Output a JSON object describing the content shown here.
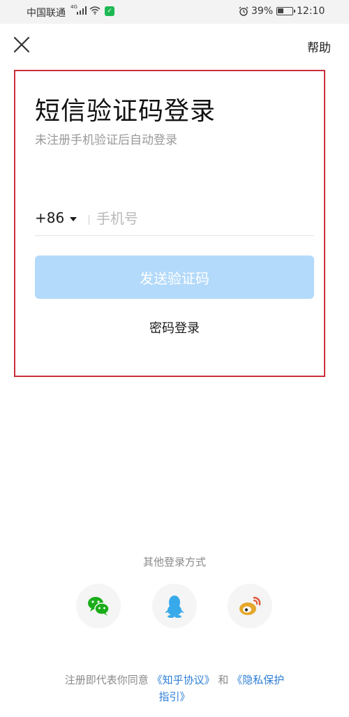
{
  "status_bar": {
    "carrier": "中国联通",
    "network": "4G",
    "battery_percent": "39%",
    "time": "12:10"
  },
  "header": {
    "close_icon": "close-icon",
    "help_label": "帮助"
  },
  "login": {
    "title": "短信验证码登录",
    "subtitle": "未注册手机验证后自动登录",
    "country_code": "+86",
    "phone_placeholder": "手机号",
    "phone_value": "",
    "send_code_label": "发送验证码",
    "password_login_label": "密码登录"
  },
  "other_login": {
    "label": "其他登录方式",
    "providers": [
      {
        "name": "wechat",
        "icon": "wechat-icon",
        "color": "#1aad19"
      },
      {
        "name": "qq",
        "icon": "qq-icon",
        "color": "#38a9ea"
      },
      {
        "name": "weibo",
        "icon": "weibo-icon",
        "color": "#e6a82c"
      }
    ]
  },
  "terms": {
    "prefix": "注册即代表你同意",
    "agreement_link": "《知乎协议》",
    "and": "和",
    "privacy_link_line1": "《隐私保护",
    "privacy_link_line2": "指引》"
  },
  "colors": {
    "highlight_border": "#c9303a",
    "button_disabled": "#b3dafa",
    "link": "#2f7fd6"
  }
}
